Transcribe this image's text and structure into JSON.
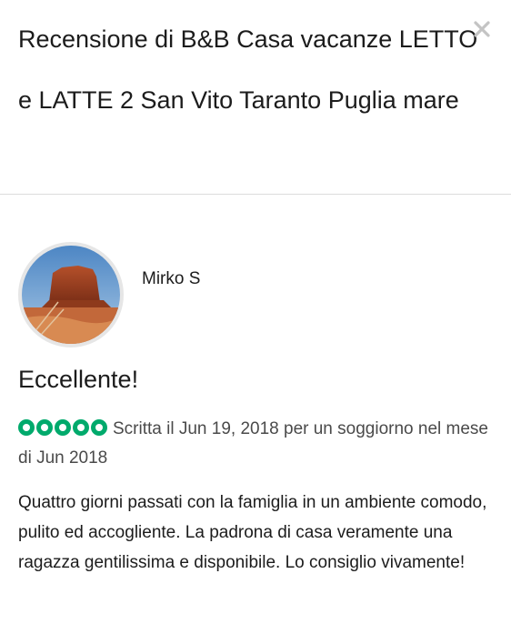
{
  "header": {
    "title": "Recensione di B&B Casa vacanze LETTO e LATTE 2 San Vito Taranto Puglia mare",
    "close_icon": "close-icon"
  },
  "review": {
    "avatar_icon": "avatar",
    "username": "Mirko S",
    "headline": "Eccellente!",
    "rating": {
      "value": 5,
      "max": 5,
      "color": "#00aa6c"
    },
    "meta": "Scritta il Jun 19, 2018 per un soggiorno nel mese di Jun 2018",
    "body": "Quattro giorni passati con la famiglia in un ambiente comodo, pulito ed accogliente. La padrona di casa veramente una ragazza gentilissima e disponibile. Lo consiglio vivamente!"
  }
}
